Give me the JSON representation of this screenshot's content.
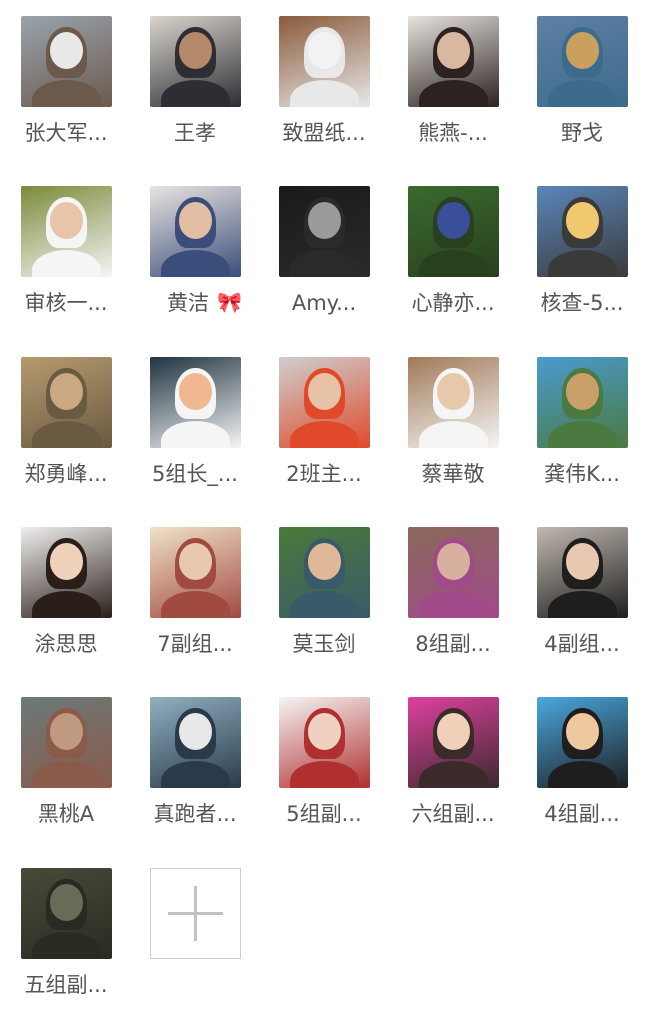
{
  "members": [
    {
      "name": "张大军...",
      "colors": [
        "#9aa3ad",
        "#e8e8e8",
        "#6b5a4c"
      ]
    },
    {
      "name": "王孝",
      "colors": [
        "#d9d4cc",
        "#b58a6c",
        "#2d2d33"
      ]
    },
    {
      "name": "致盟纸...",
      "colors": [
        "#8a5a3a",
        "#f2f2f2",
        "#e8e8e8"
      ]
    },
    {
      "name": "熊燕-...",
      "colors": [
        "#e6e2de",
        "#d9b8a0",
        "#2b2221"
      ]
    },
    {
      "name": "野戈",
      "colors": [
        "#5f7fa6",
        "#c9a15c",
        "#3e6b8c"
      ]
    },
    {
      "name": "审核一...",
      "colors": [
        "#7a8b3a",
        "#e8c5a8",
        "#f5f5f5"
      ]
    },
    {
      "name": "黄洁",
      "colors": [
        "#e9e4e0",
        "#e2bfa4",
        "#3b4d7a"
      ],
      "emoji": "🎀"
    },
    {
      "name": "Amy...",
      "colors": [
        "#1a1a1a",
        "#9a9a9a",
        "#2a2a2a"
      ]
    },
    {
      "name": "心静亦...",
      "colors": [
        "#3a6a2e",
        "#3a4e9a",
        "#28401e"
      ]
    },
    {
      "name": "核查-5...",
      "colors": [
        "#5a86bb",
        "#f0c870",
        "#3a3a3a"
      ]
    },
    {
      "name": "郑勇峰...",
      "colors": [
        "#b59a6e",
        "#c9a882",
        "#6a5a42"
      ]
    },
    {
      "name": "5组长_...",
      "colors": [
        "#1f3340",
        "#f0b890",
        "#f5f5f5"
      ]
    },
    {
      "name": "2班主...",
      "colors": [
        "#cfcfcf",
        "#e8c2a6",
        "#e04a2a"
      ]
    },
    {
      "name": "蔡華敬",
      "colors": [
        "#a07a58",
        "#e8c8aa",
        "#f5f5f5"
      ]
    },
    {
      "name": "龚伟K...",
      "colors": [
        "#4a9ad0",
        "#c9a06a",
        "#4a7a40"
      ]
    },
    {
      "name": "涂思思",
      "colors": [
        "#f0efee",
        "#f0d2bc",
        "#2a1e1a"
      ]
    },
    {
      "name": "7副组...",
      "colors": [
        "#f0e2c8",
        "#e8c8b0",
        "#a04a40"
      ]
    },
    {
      "name": "莫玉剑",
      "colors": [
        "#4a7a3a",
        "#e0b898",
        "#3a5a6a"
      ]
    },
    {
      "name": "8组副...",
      "colors": [
        "#8a6a5a",
        "#d8b0a0",
        "#a04a8a"
      ]
    },
    {
      "name": "4副组...",
      "colors": [
        "#c0b8b0",
        "#e8c8b0",
        "#1e1e1e"
      ]
    },
    {
      "name": "黑桃A",
      "colors": [
        "#6a7a7a",
        "#c09a80",
        "#8a5a4a"
      ]
    },
    {
      "name": "真跑者...",
      "colors": [
        "#8fb0c0",
        "#e8e8e8",
        "#2a3a4a"
      ]
    },
    {
      "name": "5组副...",
      "colors": [
        "#f5f5f5",
        "#f0d0c0",
        "#b03030"
      ]
    },
    {
      "name": "六组副...",
      "colors": [
        "#e040a0",
        "#f0d0b8",
        "#3a2a2a"
      ]
    },
    {
      "name": "4组副...",
      "colors": [
        "#49a8e0",
        "#f0c8a0",
        "#1e1e1e"
      ]
    },
    {
      "name": "五组副...",
      "colors": [
        "#4a4a3a",
        "#6a6a58",
        "#2a2a22"
      ]
    }
  ],
  "add_button": {
    "icon": "plus-icon"
  }
}
